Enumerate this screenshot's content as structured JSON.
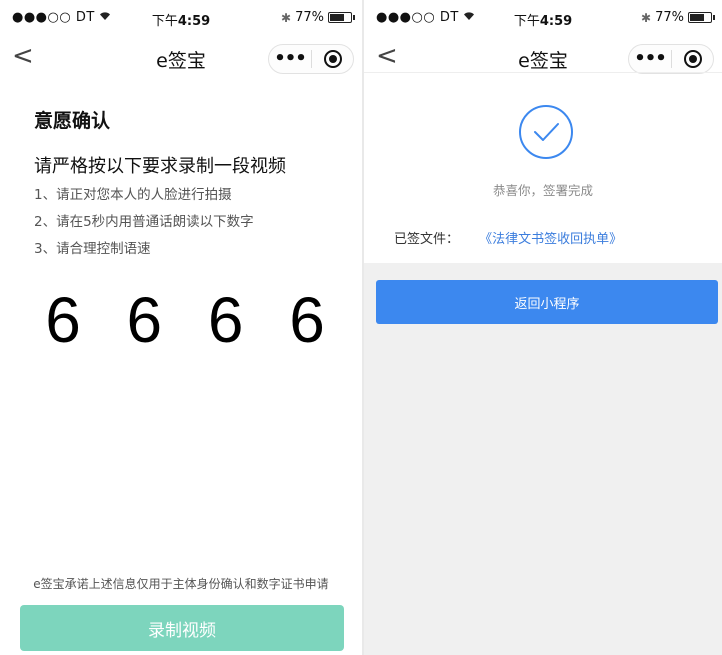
{
  "status_bar": {
    "carrier": "●●●○○ DT",
    "wifi_icon": "wifi-icon",
    "time_prefix": "下午",
    "time": "4:59",
    "bluetooth_icon": "bluetooth-icon",
    "battery": "77%"
  },
  "navbar": {
    "back": "<",
    "title": "e签宝",
    "more": "•••"
  },
  "left": {
    "heading": "意愿确认",
    "subheading": "请严格按以下要求录制一段视频",
    "instructions": [
      "1、请正对您本人的人脸进行拍摄",
      "2、请在5秒内用普通话朗读以下数字",
      "3、请合理控制语速"
    ],
    "digits": [
      "6",
      "6",
      "6",
      "6"
    ],
    "disclaimer": "e签宝承诺上述信息仅用于主体身份确认和数字证书申请",
    "record_button": "录制视频",
    "colors": {
      "record_button": "#7dd5bd"
    }
  },
  "right": {
    "success_icon": "check-circle-icon",
    "success_text": "恭喜你，签署完成",
    "signed_label": "已签文件：",
    "signed_file": "《法律文书签收回执单》",
    "return_button": "返回小程序",
    "colors": {
      "accent": "#3c88ef",
      "link": "#3b7ddd"
    }
  }
}
